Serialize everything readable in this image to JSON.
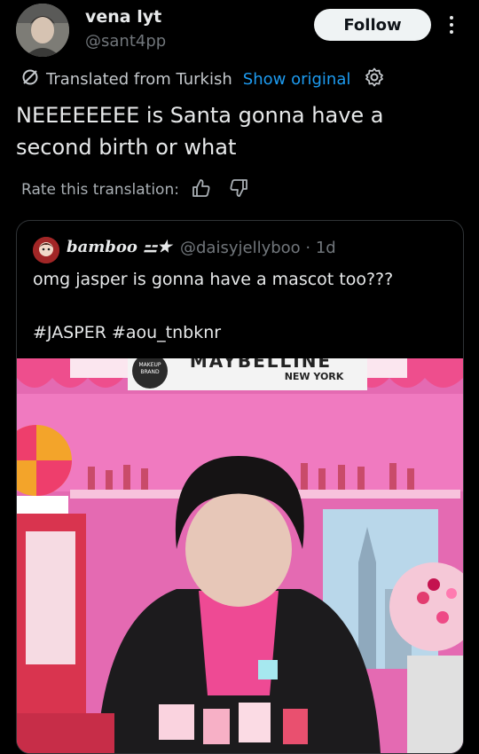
{
  "author": {
    "display_name": "vena lyt",
    "handle": "@sant4pp"
  },
  "follow_label": "Follow",
  "translation": {
    "text": "Translated from Turkish",
    "show_original": "Show original"
  },
  "tweet_text": "NEEEEEEEE is Santa gonna have a second birth or what",
  "rate_label": "Rate this translation:",
  "quote": {
    "display_name": "bamboo ⚍★",
    "handle": "@daisyjellyboo · 1d",
    "text": "omg jasper is gonna have a mascot too???",
    "hashtags": "#JASPER #aou_tnbknr",
    "media_text": {
      "brand": "MAYBELLINE",
      "city": "NEW YORK",
      "badge_line1": "MAKEUP",
      "badge_line2": "BRAND"
    }
  },
  "icons": [
    "more-vertical-icon",
    "translate-icon",
    "gear-icon",
    "thumbs-up-icon",
    "thumbs-down-icon"
  ]
}
